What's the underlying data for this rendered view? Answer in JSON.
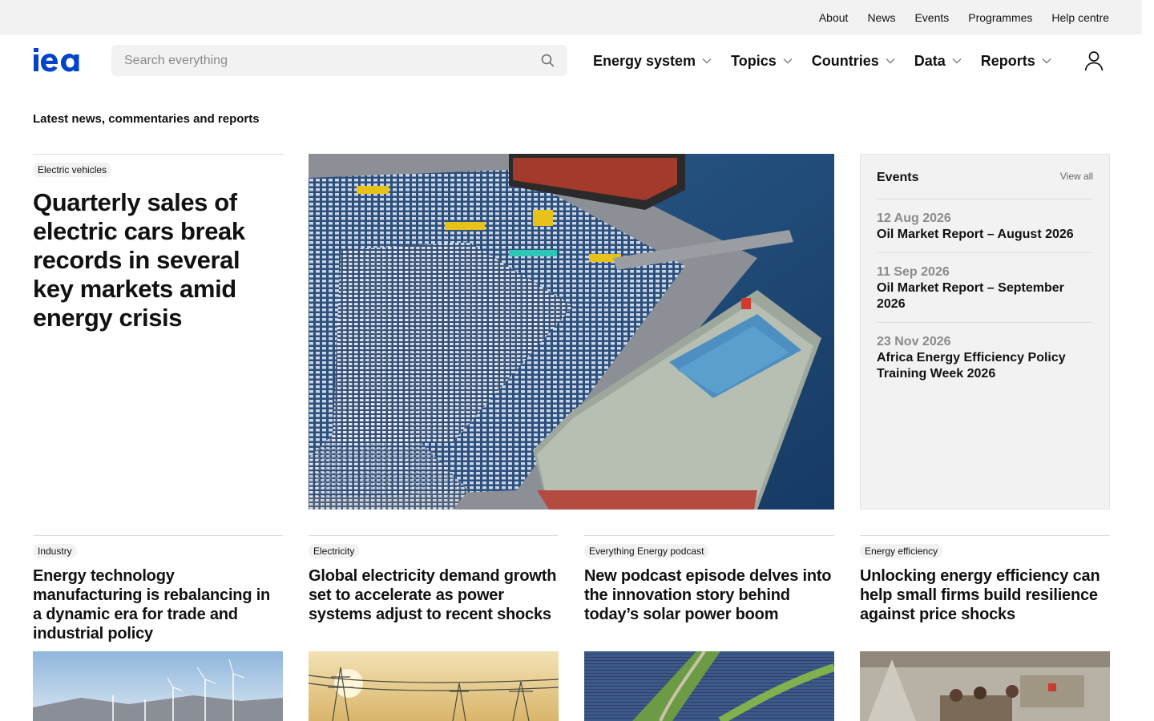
{
  "utility_nav": [
    "About",
    "News",
    "Events",
    "Programmes",
    "Help centre"
  ],
  "header": {
    "logo": "iea",
    "search_placeholder": "Search everything",
    "nav": [
      "Energy system",
      "Topics",
      "Countries",
      "Data",
      "Reports"
    ]
  },
  "section_title": "Latest news, commentaries and reports",
  "featured": {
    "tag": "Electric vehicles",
    "title": "Quarterly sales of electric cars break records in several key markets amid energy crisis"
  },
  "events": {
    "title": "Events",
    "view_all": "View all",
    "items": [
      {
        "date": "12 Aug 2026",
        "title": "Oil Market Report – August 2026"
      },
      {
        "date": "11 Sep 2026",
        "title": "Oil Market Report – September 2026"
      },
      {
        "date": "23 Nov 2026",
        "title": "Africa Energy Efficiency Policy Training Week 2026"
      }
    ]
  },
  "cards": [
    {
      "tag": "Industry",
      "title": "Energy technology manufacturing is rebalancing in a dynamic era for trade and industrial policy"
    },
    {
      "tag": "Electricity",
      "title": "Global electricity demand growth set to accelerate as power systems adjust to recent shocks"
    },
    {
      "tag": "Everything Energy podcast",
      "title": "New podcast episode delves into the innovation story behind today’s solar power boom"
    },
    {
      "tag": "Energy efficiency",
      "title": "Unlocking energy efficiency can help small firms build resilience against price shocks"
    }
  ],
  "colors": {
    "brand_blue": "#0044cc",
    "panel_gray": "#f2f2f2",
    "date_gray": "#8a8a8a"
  }
}
